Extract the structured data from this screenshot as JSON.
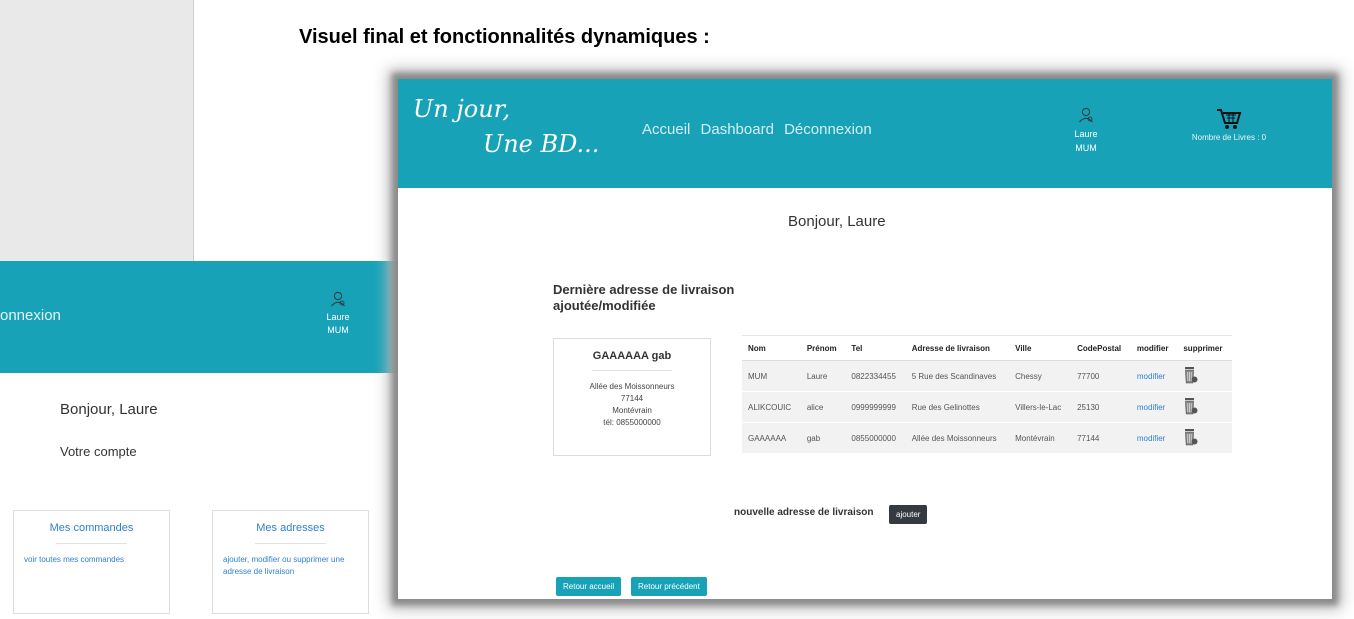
{
  "doc": {
    "title": "Visuel final et fonctionnalités dynamiques :"
  },
  "left": {
    "nav_partial": "onnexion",
    "user_first": "Laure",
    "user_last": "MUM",
    "hello": "Bonjour, Laure",
    "account": "Votre compte",
    "cards": [
      {
        "title": "Mes commandes",
        "link": "voir toutes mes commandes"
      },
      {
        "title": "Mes adresses",
        "link": "ajouter, modifier ou supprimer une adresse de livraison"
      }
    ]
  },
  "main": {
    "logo_line1": "Un jour,",
    "logo_line2": "Une BD...",
    "nav": [
      "Accueil",
      "Dashboard",
      "Déconnexion"
    ],
    "user_first": "Laure",
    "user_last": "MUM",
    "cart_label": "Nombre de Livres : 0",
    "hello": "Bonjour, Laure",
    "last_address_title": "Dernière adresse de livraison ajoutée/modifiée",
    "last_address": {
      "name": "GAAAAAA gab",
      "street": "Allée des Moissonneurs",
      "zip": "77144",
      "city": "Montévrain",
      "phone": "tél: 0855000000"
    },
    "table": {
      "headers": [
        "Nom",
        "Prénom",
        "Tel",
        "Adresse de livraison",
        "Ville",
        "CodePostal",
        "modifier",
        "supprimer"
      ],
      "rows": [
        [
          "MUM",
          "Laure",
          "0822334455",
          "5 Rue des Scandinaves",
          "Chessy",
          "77700",
          "modifier"
        ],
        [
          "ALIKCOUIC",
          "alice",
          "0999999999",
          "Rue des Gelinottes",
          "Villers-le-Lac",
          "25130",
          "modifier"
        ],
        [
          "GAAAAAA",
          "gab",
          "0855000000",
          "Allée des Moissonneurs",
          "Montévrain",
          "77144",
          "modifier"
        ]
      ]
    },
    "new_address_label": "nouvelle adresse de livraison",
    "add_button": "ajouter",
    "home_button": "Retour accueil",
    "back_button": "Retour précédent"
  },
  "icons": {
    "user": "user-icon",
    "cart": "cart-icon",
    "trash": "trash-icon"
  },
  "colors": {
    "header": "#17a2b8",
    "link": "#2f7fd1",
    "dark_button": "#343a40"
  }
}
